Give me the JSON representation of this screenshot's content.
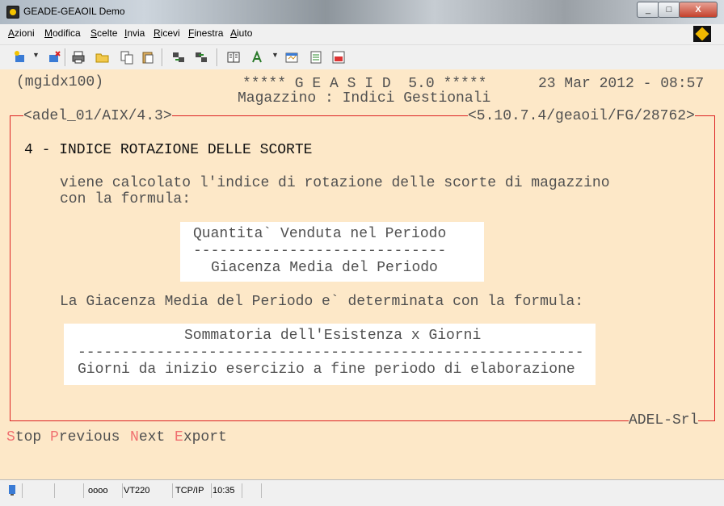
{
  "window": {
    "title": "GEADE-GEAOIL Demo",
    "min": "_",
    "max": "□",
    "close": "X"
  },
  "menu": [
    {
      "hk": "A",
      "rest": "zioni"
    },
    {
      "hk": "M",
      "rest": "odifica"
    },
    {
      "hk": "S",
      "rest": "celte"
    },
    {
      "hk": "I",
      "rest": "nvia"
    },
    {
      "hk": "R",
      "rest": "icevi"
    },
    {
      "hk": "F",
      "rest": "inestra"
    },
    {
      "hk": "A",
      "rest": "iuto"
    }
  ],
  "terminal": {
    "program": "(mgidx100)",
    "banner": "***** G E A S I D  5.0 *****",
    "datetime": "23 Mar 2012 - 08:57",
    "subtitle": "Magazzino : Indici Gestionali",
    "frame_left": "<adel_01/AIX/4.3>",
    "frame_right": "<5.10.7.4/geaoil/FG/28762>",
    "frame_bottom": "ADEL-Srl",
    "heading": "4 - INDICE ROTAZIONE DELLE SCORTE",
    "line1": "viene calcolato l'indice di rotazione delle scorte di magazzino",
    "line2": "con la formula:",
    "formula1": {
      "numerator": "Quantita` Venduta nel Periodo",
      "rule": "-----------------------------",
      "denominator": "Giacenza Media del Periodo"
    },
    "line3": "La Giacenza Media del Periodo e` determinata con la formula:",
    "formula2": {
      "numerator": "Sommatoria dell'Esistenza x Giorni",
      "rule": "----------------------------------------------------------",
      "denominator": "Giorni da inizio esercizio a fine periodo di elaborazione"
    },
    "fkeys": [
      {
        "hk": "S",
        "rest": "top"
      },
      {
        "hk": "P",
        "rest": "revious"
      },
      {
        "hk": "N",
        "rest": "ext"
      },
      {
        "hk": "E",
        "rest": "xport"
      }
    ]
  },
  "status": {
    "indicator": "oooo",
    "emulation": "VT220",
    "protocol": "TCP/IP",
    "time": "10:35"
  }
}
